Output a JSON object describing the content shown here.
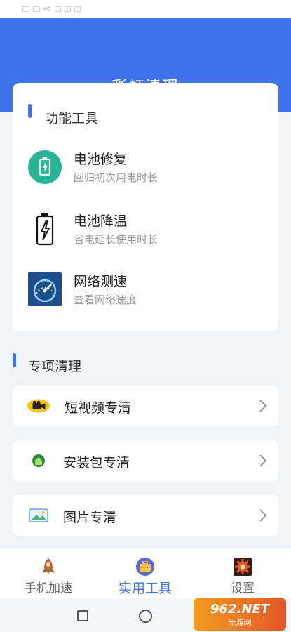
{
  "status_bar": {
    "text": "HD"
  },
  "header": {
    "title": "彩虹清理"
  },
  "tools_section": {
    "title": "功能工具",
    "items": [
      {
        "title": "电池修复",
        "subtitle": "回归初次用电时长",
        "icon": "battery-repair-icon"
      },
      {
        "title": "电池降温",
        "subtitle": "省电延长使用时长",
        "icon": "battery-cool-icon"
      },
      {
        "title": "网络测速",
        "subtitle": "查看网络速度",
        "icon": "speedometer-icon"
      }
    ]
  },
  "special_section": {
    "title": "专项清理",
    "items": [
      {
        "label": "短视频专清",
        "icon": "video-camera-icon"
      },
      {
        "label": "安装包专清",
        "icon": "android-package-icon"
      },
      {
        "label": "图片专清",
        "icon": "picture-icon"
      }
    ]
  },
  "tabbar": {
    "tabs": [
      {
        "label": "手机加速",
        "icon": "rocket-icon",
        "active": false
      },
      {
        "label": "实用工具",
        "icon": "toolbox-icon",
        "active": true
      },
      {
        "label": "设置",
        "icon": "gear-icon",
        "active": false
      }
    ]
  },
  "watermark": {
    "line1": "962.NET",
    "line2": "乐游网"
  },
  "colors": {
    "primary": "#3f73ee",
    "background": "#f1f3f6",
    "repair_green": "#27b596"
  }
}
